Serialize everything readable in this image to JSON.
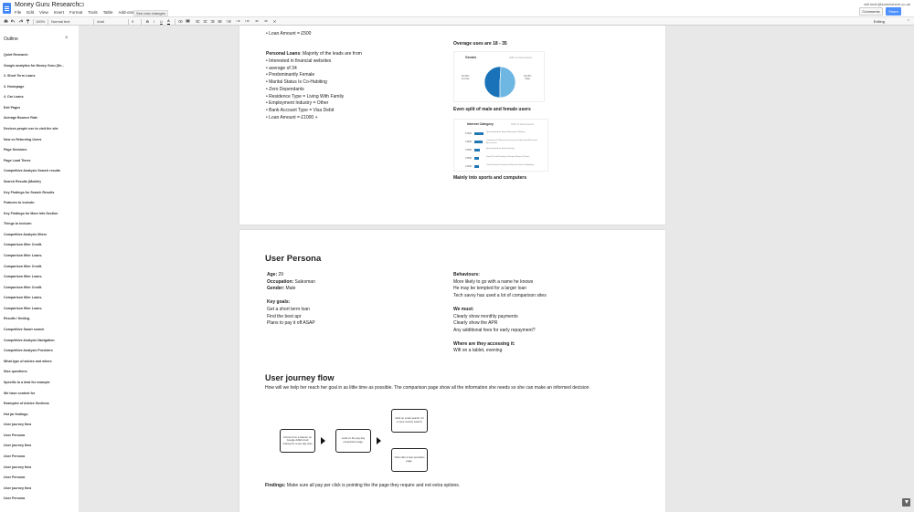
{
  "window": {
    "doc_title": "Money Guru Research",
    "user_email": "will.lorsh@somewhere.co.uk",
    "menu": [
      "File",
      "Edit",
      "View",
      "Insert",
      "Format",
      "Tools",
      "Table",
      "Add-ons",
      "Help"
    ],
    "see_changes": "See new changes",
    "comments_label": "Comments",
    "share_label": "Share",
    "editing_label": "Editing"
  },
  "toolbar": {
    "zoom": "100%",
    "style": "Normal text",
    "font": "Arial",
    "size": "9"
  },
  "outline": {
    "title": "Outline",
    "items": [
      "Quint Research",
      "Google analytics for Money Guru (De...",
      "2. Short Term Loans",
      "3. Homepage",
      "4. Car Loans",
      "Exit Pages",
      "Average Bounce Rate",
      "Devices people use to visit the site",
      "New vs Returning Users",
      "Page Sessions",
      "Page Load Times",
      "Competitive Analysis Search results",
      "Search Results (Mobile)",
      "Key Findings for Search Results",
      "Features to include:",
      "Key Findings for More Info Section",
      "Things to include:",
      "Competitive Analysis filters",
      "Comparison filter Credit.",
      "Comparison filter Loans.",
      "Comparison filter Credit.",
      "Comparison filter Loans.",
      "Comparison filter Credit.",
      "Comparison filter Loans.",
      "Comparison filter Loans.",
      "Results / finding.",
      "Competitive Smart search",
      "Competitive Analysis Navigation",
      "Competitive Analysis Providers",
      "What type of advice and where.",
      "Nice questions",
      "Specific to a deal for example",
      "We have content for",
      "Examples of Advice Sections",
      "Hot jar findings.",
      "User journey flow",
      "User Persona",
      "User journey flow",
      "User Persona",
      "User journey flow",
      "User Persona",
      "User journey flow",
      "User Persona"
    ]
  },
  "page1": {
    "loan_top": "• Loan Amount = £500",
    "personal_loans_heading": "Personal Loans",
    "personal_loans_intro": ": Majority of the leads are from",
    "bullets": [
      "• Interested in financial websites",
      "• average of 34",
      "• Predominantly Female",
      "• Marital Status Is Co-Habiting",
      "• Zero Dependants",
      "• Residence Type = Living With Family",
      "• Employment Industry = Other",
      "• Bank Account Type = Visa Debit",
      "• Loan Amount = £1000 +"
    ],
    "overage": "Overage uses are 18 - 35",
    "gender_card": {
      "title": "Gender",
      "note": "100% of total sessions",
      "female_label": "50.95%\nFemale",
      "male_label": "49.05%\nMale"
    },
    "even_split": "Even split of male and female users",
    "interest_card": {
      "title": "Interest Category",
      "note": "100% of total sessions"
    },
    "sports": "Mainly into sports and computers"
  },
  "chart_data": [
    {
      "type": "pie",
      "title": "Gender",
      "categories": [
        "Female",
        "Male"
      ],
      "values": [
        50.95,
        49.05
      ],
      "colors": [
        "#1a73b8",
        "#6fb7e3"
      ]
    },
    {
      "type": "bar",
      "title": "Interest Category",
      "categories": [
        "Sports/Individual Sports/Running & Walking",
        "Computers & Electronics/Consumer Electronics/Electronic Accessories",
        "Sports/Individual Sports/Cycling",
        "Food & Drink/Cooking & Recipes/Soups & Stews",
        "Travel/Tourist Destinations/Historical Sites & Buildings"
      ],
      "values": [
        5.56,
        4.85,
        3.56,
        2.85,
        2.66
      ],
      "value_labels": [
        "5.56%",
        "4.85%",
        "3.56%",
        "2.85%",
        "2.66%"
      ]
    }
  ],
  "page2": {
    "persona_heading": "User Persona",
    "age_label": "Age:",
    "age_value": " 29",
    "occupation_label": "Occupation:",
    "occupation_value": " Salesman",
    "gender_label": "Gender:",
    "gender_value": " Male",
    "key_goals": "Key goals:",
    "goals": [
      "Get a short term loan",
      "Find the best apr",
      "Plans to pay it off ASAP"
    ],
    "behaviours": "Behaviours:",
    "behaviour_items": [
      "More likely to go with a name he knows",
      "He may be tempted for a larger loan",
      "Tech savvy has used a lot of comparison sites"
    ],
    "we_must": "We must:",
    "must_items": [
      "Clearly show monthly payments",
      "Clearly show the APR",
      "Any additional fees for early repayment?"
    ],
    "where": "Where are they accessing it:",
    "where_value": "Wifi on a tablet, evening",
    "journey_heading": "User  journey flow",
    "journey_intro": "How will we help her reach her goal in as little time as possible. The comparison page show all the information she needs so she can make an informed decision",
    "flow": {
      "box1": "Arrives from a listener on Google AdWord ad looking for a pay day loan",
      "box2": "Land on the pay day comparison page.",
      "box3": "Click on smart search, for a more custom search.",
      "box4": "Click offer a loan providers page."
    },
    "findings_label": "Findings:",
    "findings_text": " Make sure all pay per click is pointing the the page they require and not extra options."
  }
}
